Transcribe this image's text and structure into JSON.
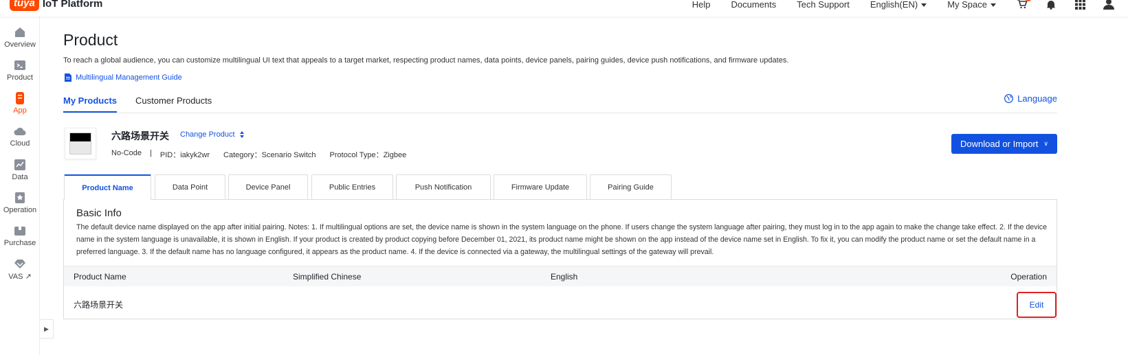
{
  "app": {
    "logo_badge": "tuya",
    "logo_text": "IoT Platform"
  },
  "topnav": {
    "help": "Help",
    "documents": "Documents",
    "tech_support": "Tech Support",
    "language": "English(EN)",
    "space": "My Space"
  },
  "sidebar": {
    "items": [
      {
        "label": "Overview",
        "icon": "home-icon"
      },
      {
        "label": "Product",
        "icon": "terminal-icon"
      },
      {
        "label": "App",
        "icon": "phone-icon"
      },
      {
        "label": "Cloud",
        "icon": "cloud-icon"
      },
      {
        "label": "Data",
        "icon": "chart-icon"
      },
      {
        "label": "Operation",
        "icon": "star-icon"
      },
      {
        "label": "Purchase",
        "icon": "box-icon"
      },
      {
        "label": "VAS ↗",
        "icon": "diamond-icon"
      }
    ],
    "active_index": 2
  },
  "page": {
    "title": "Product",
    "description": "To reach a global audience, you can customize multilingual UI text that appeals to a target market, respecting product names, data points, device panels, pairing guides, device push notifications, and firmware updates.",
    "guide_link": "Multilingual Management Guide",
    "tabs": [
      "My Products",
      "Customer Products"
    ],
    "language_link": "Language"
  },
  "product": {
    "name": "六路场景开关",
    "change_label": "Change Product",
    "type": "No-Code",
    "separator": "|",
    "pid": "PID：iakyk2wr",
    "category": "Category：Scenario Switch",
    "protocol": "Protocol Type：Zigbee",
    "download_button": "Download or Import"
  },
  "subtabs": [
    "Product Name",
    "Data Point",
    "Device Panel",
    "Public Entries",
    "Push Notification",
    "Firmware Update",
    "Pairing Guide"
  ],
  "basic_info": {
    "title": "Basic Info",
    "description": "The default device name displayed on the app after initial pairing. Notes: 1. If multilingual options are set, the device name is shown in the system language on the phone. If users change the system language after pairing, they must log in to the app again to make the change take effect. 2. If the device name in the system language is unavailable, it is shown in English. If your product is created by product copying before December 01, 2021, its product name might be shown on the app instead of the device name set in English. To fix it, you can modify the product name or set the default name in a preferred language. 3. If the default name has no language configured, it appears as the product name. 4. If the device is connected via a gateway, the multilingual settings of the gateway will prevail."
  },
  "table": {
    "headers": [
      "Product Name",
      "Simplified Chinese",
      "English",
      "Operation"
    ],
    "rows": [
      {
        "product_name": "六路场景开关",
        "simplified_chinese": "",
        "english": "",
        "operation": "Edit"
      }
    ]
  },
  "colors": {
    "brand": "#ff4800",
    "primary": "#1352e0",
    "highlight": "#e02020"
  }
}
